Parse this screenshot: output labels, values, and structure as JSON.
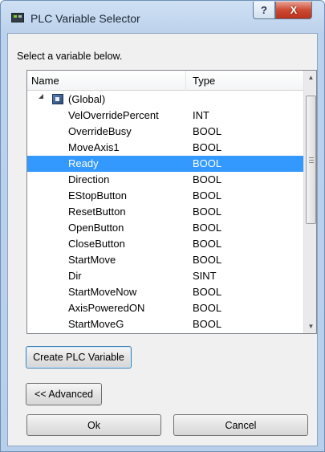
{
  "window": {
    "title": "PLC Variable Selector",
    "help_glyph": "?",
    "close_glyph": "X"
  },
  "instruction": "Select a variable below.",
  "tree": {
    "headers": {
      "name": "Name",
      "type": "Type"
    },
    "group": {
      "label": "(Global)",
      "expanded": true
    },
    "rows": [
      {
        "name": "VelOverridePercent",
        "type": "INT"
      },
      {
        "name": "OverrideBusy",
        "type": "BOOL"
      },
      {
        "name": "MoveAxis1",
        "type": "BOOL"
      },
      {
        "name": "Ready",
        "type": "BOOL"
      },
      {
        "name": "Direction",
        "type": "BOOL"
      },
      {
        "name": "EStopButton",
        "type": "BOOL"
      },
      {
        "name": "ResetButton",
        "type": "BOOL"
      },
      {
        "name": "OpenButton",
        "type": "BOOL"
      },
      {
        "name": "CloseButton",
        "type": "BOOL"
      },
      {
        "name": "StartMove",
        "type": "BOOL"
      },
      {
        "name": "Dir",
        "type": "SINT"
      },
      {
        "name": "StartMoveNow",
        "type": "BOOL"
      },
      {
        "name": "AxisPoweredON",
        "type": "BOOL"
      },
      {
        "name": "StartMoveG",
        "type": "BOOL"
      }
    ],
    "selected_variable": "Ready",
    "scroll": {
      "up_glyph": "▲",
      "down_glyph": "▼"
    }
  },
  "buttons": {
    "create": "Create PLC Variable",
    "advanced": "<< Advanced",
    "ok": "Ok",
    "cancel": "Cancel"
  },
  "colors": {
    "selection": "#3399ff",
    "close_button": "#cf4a33",
    "title_bar": "#bcd2ec"
  }
}
